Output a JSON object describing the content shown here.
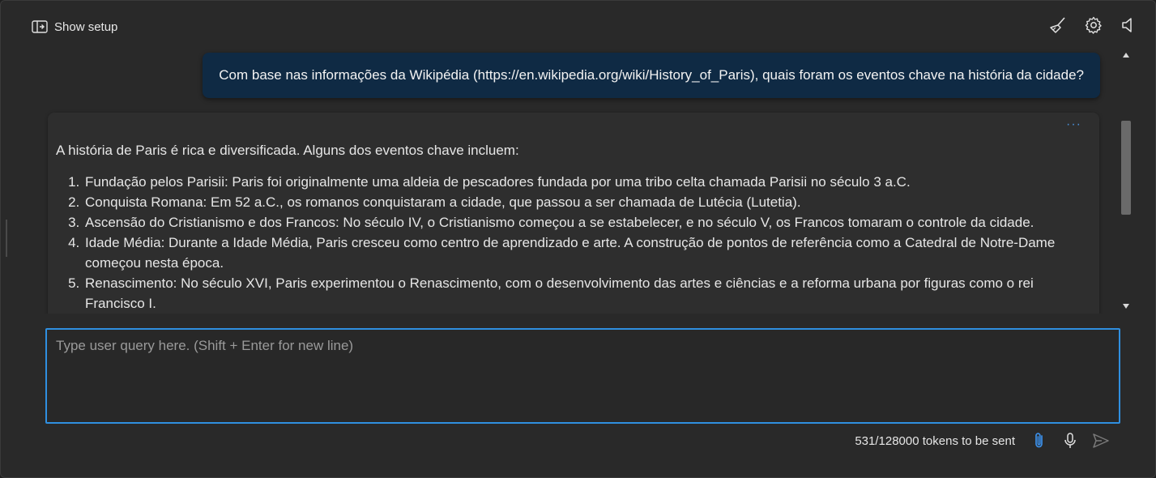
{
  "header": {
    "show_setup_label": "Show setup",
    "icons": [
      "panel-toggle-icon",
      "clear-chat-broom-icon",
      "settings-gear-icon",
      "speaker-icon"
    ]
  },
  "chat": {
    "user_message": "Com base nas informações da Wikipédia (https://en.wikipedia.org/wiki/History_of_Paris), quais foram os eventos chave na história da cidade?",
    "assistant_more": "···",
    "assistant_intro": "A história de Paris é rica e diversificada. Alguns dos eventos chave incluem:",
    "assistant_items": [
      "Fundação pelos Parisii: Paris foi originalmente uma aldeia de pescadores fundada por uma tribo celta chamada Parisii no século 3 a.C.",
      "Conquista Romana: Em 52 a.C., os romanos conquistaram a cidade, que passou a ser chamada de Lutécia (Lutetia).",
      "Ascensão do Cristianismo e dos Francos: No século IV, o Cristianismo começou a se estabelecer, e no século V, os Francos tomaram o controle da cidade.",
      "Idade Média: Durante a Idade Média, Paris cresceu como centro de aprendizado e arte. A construção de pontos de referência como a Catedral de Notre-Dame começou nesta época.",
      "Renascimento: No século XVI, Paris experimentou o Renascimento, com o desenvolvimento das artes e ciências e a reforma urbana por figuras como o rei Francisco I."
    ]
  },
  "input": {
    "placeholder": "Type user query here. (Shift + Enter for new line)",
    "value": ""
  },
  "footer": {
    "token_count": "531/128000 tokens to be sent",
    "icons": [
      "attach-paperclip-icon",
      "microphone-icon",
      "send-icon"
    ]
  },
  "colors": {
    "background": "#292929",
    "user_bubble": "#0f2a44",
    "assistant_card": "#2e2e2e",
    "accent": "#2f8fe0"
  }
}
